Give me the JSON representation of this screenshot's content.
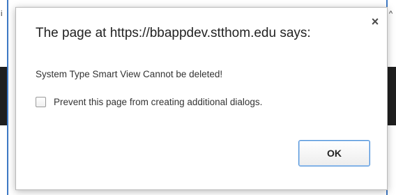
{
  "dialog": {
    "title": "The page at https://bbappdev.stthom.edu says:",
    "message": "System Type Smart View Cannot be deleted!",
    "prevent_label": "Prevent this page from creating additional dialogs.",
    "prevent_checked": false,
    "ok_label": "OK",
    "close_glyph": "×"
  },
  "background": {
    "left_mark": "i",
    "right_mark": "^"
  },
  "icons": {
    "close": "close-icon",
    "checkbox": "checkbox-icon"
  },
  "colors": {
    "accent": "#4a8fd8",
    "page_edge": "#3d78c4",
    "backdrop_band": "#1f1f1f"
  }
}
